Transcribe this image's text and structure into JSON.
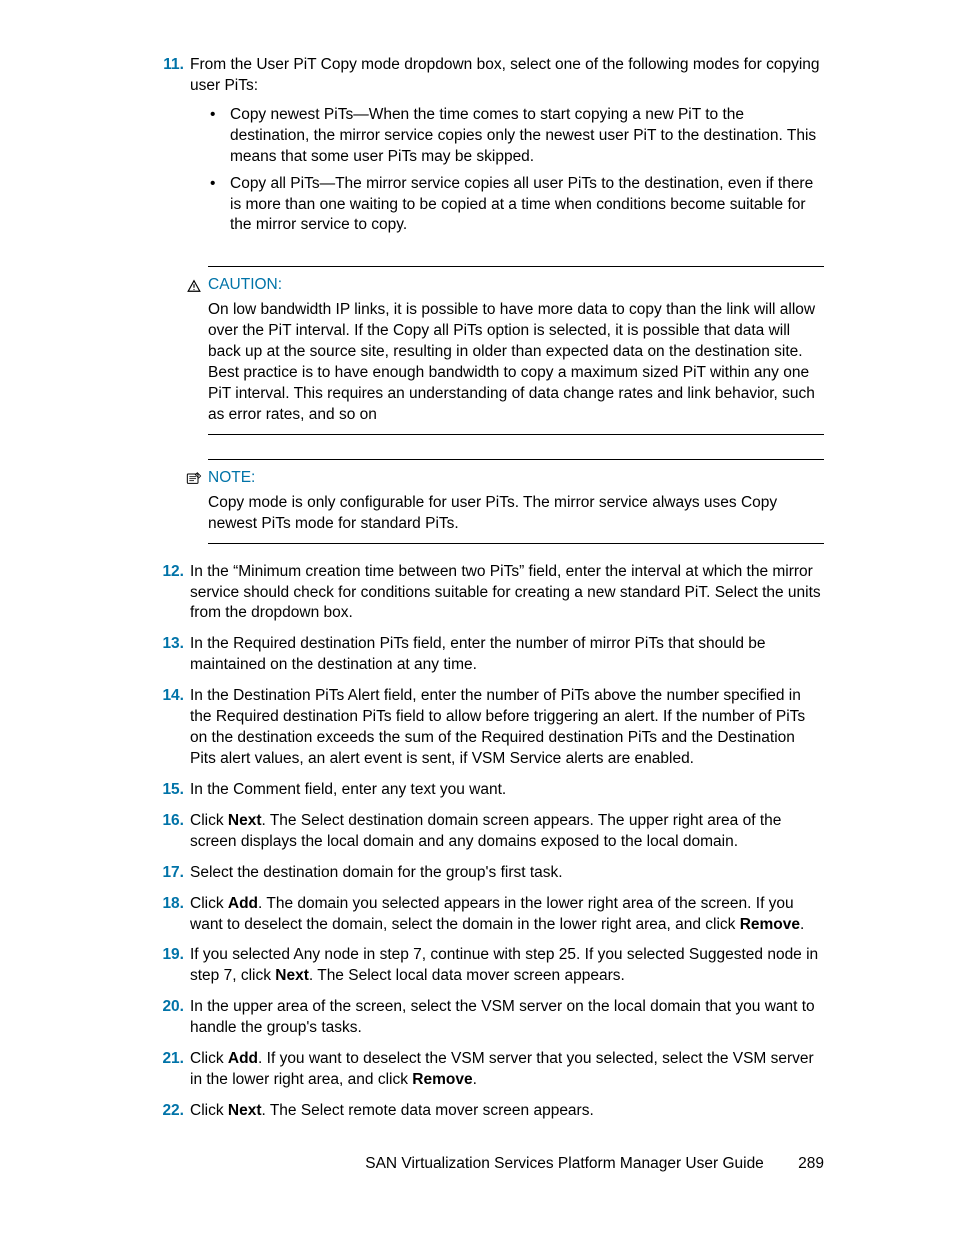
{
  "steps": {
    "s11": {
      "num": "11.",
      "text": "From the User PiT Copy mode dropdown box, select one of the following modes for copying user PiTs:",
      "bullets": [
        "Copy newest PiTs—When the time comes to start copying a new PiT to the destination, the mirror service copies only the newest user PiT to the destination. This means that some user PiTs may be skipped.",
        "Copy all PiTs—The mirror service copies all user PiTs to the destination, even if there is more than one waiting to be copied at a time when conditions become suitable for the mirror service to copy."
      ]
    },
    "caution": {
      "title": "CAUTION:",
      "body": "On low bandwidth IP links, it is possible to have more data to copy than the link will allow over the PiT interval. If the Copy all PiTs option is selected, it is possible that data will back up at the source site, resulting in older than expected data on the destination site. Best practice is to have enough bandwidth to copy a maximum sized PiT within any one PiT interval. This requires an understanding of data change rates and link behavior, such as error rates, and so on"
    },
    "note": {
      "title": "NOTE:",
      "body": "Copy mode is only configurable for user PiTs. The mirror service always uses Copy newest PiTs mode for standard PiTs."
    },
    "s12": {
      "num": "12.",
      "text": "In the “Minimum creation time between two PiTs” field, enter the interval at which the mirror service should check for conditions suitable for creating a new standard PiT. Select the units from the dropdown box."
    },
    "s13": {
      "num": "13.",
      "text": "In the Required destination PiTs field, enter the number of mirror PiTs that should be maintained on the destination at any time."
    },
    "s14": {
      "num": "14.",
      "text": "In the Destination PiTs Alert field, enter the number of PiTs above the number specified in the Required destination PiTs field to allow before triggering an alert. If the number of PiTs on the destination exceeds the sum of the Required destination PiTs and the Destination Pits alert values, an alert event is sent, if VSM Service alerts are enabled."
    },
    "s15": {
      "num": "15.",
      "text": "In the Comment field, enter any text you want."
    },
    "s16": {
      "num": "16.",
      "pre": "Click ",
      "b1": "Next",
      "post": ". The Select destination domain screen appears. The upper right area of the screen displays the local domain and any domains exposed to the local domain."
    },
    "s17": {
      "num": "17.",
      "text": "Select the destination domain for the group's first task."
    },
    "s18": {
      "num": "18.",
      "pre": "Click ",
      "b1": "Add",
      "mid": ". The domain you selected appears in the lower right area of the screen. If you want to deselect the domain, select the domain in the lower right area, and click ",
      "b2": "Remove",
      "post": "."
    },
    "s19": {
      "num": "19.",
      "pre": "If you selected Any node in step 7, continue with step 25. If you selected Suggested node in step 7, click ",
      "b1": "Next",
      "post": ". The Select local data mover screen appears."
    },
    "s20": {
      "num": "20.",
      "text": "In the upper area of the screen, select the VSM server on the local domain that you want to handle the group's tasks."
    },
    "s21": {
      "num": "21.",
      "pre": "Click ",
      "b1": "Add",
      "mid": ". If you want to deselect the VSM server that you selected, select the VSM server in the lower right area, and click ",
      "b2": "Remove",
      "post": "."
    },
    "s22": {
      "num": "22.",
      "pre": "Click ",
      "b1": "Next",
      "post": ". The Select remote data mover screen appears."
    }
  },
  "footer": {
    "title": "SAN Virtualization Services Platform Manager User Guide",
    "page": "289"
  }
}
